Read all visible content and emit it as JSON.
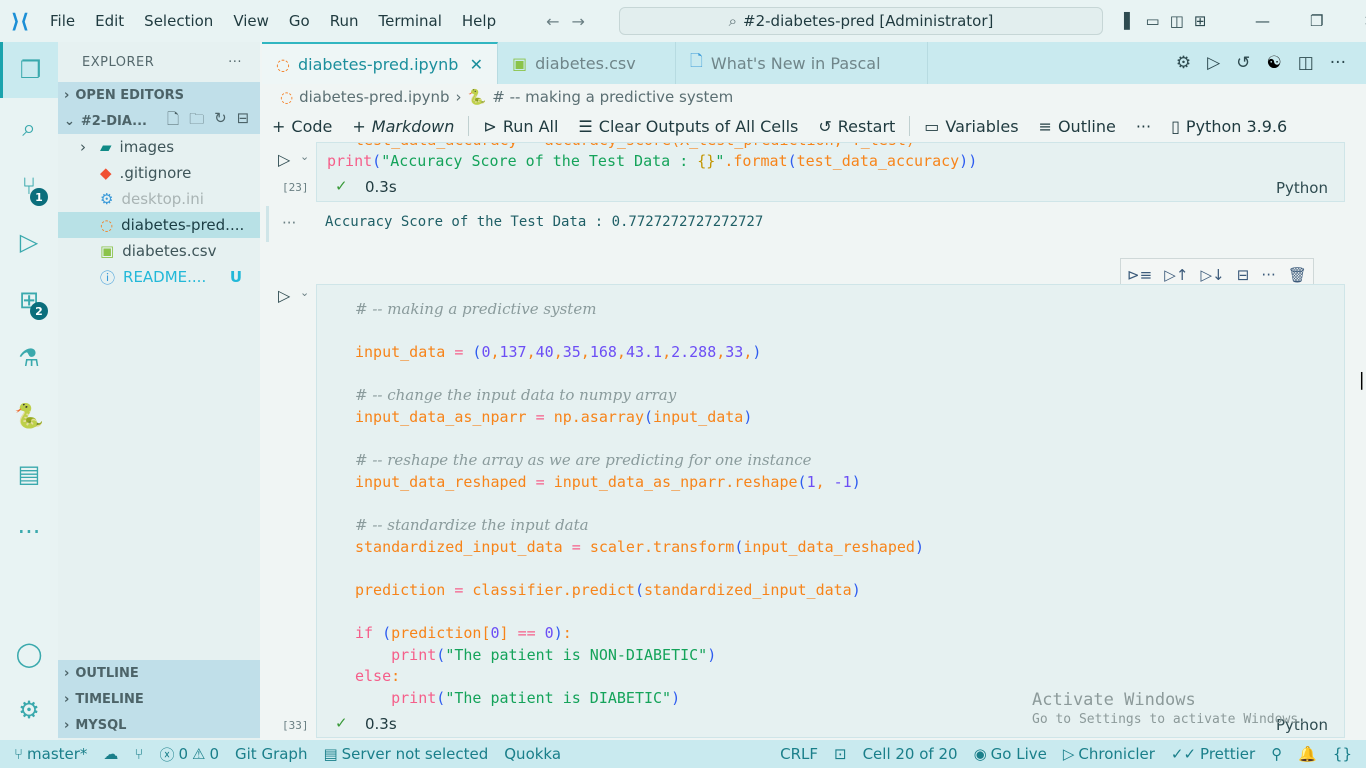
{
  "titlebar": {
    "menus": [
      "File",
      "Edit",
      "Selection",
      "View",
      "Go",
      "Run",
      "Terminal",
      "Help"
    ],
    "command_center": "#2-diabetes-pred [Administrator]"
  },
  "activity": {
    "scm_badge": "1",
    "extensions_badge": "2"
  },
  "sidebar": {
    "title": "EXPLORER",
    "more": "···",
    "open_editors": "OPEN EDITORS",
    "folder": "#2-DIA...",
    "files": [
      {
        "name": "images",
        "icon": "folder-icon",
        "color": "#3e5559"
      },
      {
        "name": ".gitignore",
        "icon": "git-icon",
        "color": "#3e5559"
      },
      {
        "name": "desktop.ini",
        "icon": "gear-icon",
        "color": "#a9b4b4"
      },
      {
        "name": "diabetes-pred....",
        "icon": "jupyter-icon",
        "color": "#1b3d44"
      },
      {
        "name": "diabetes.csv",
        "icon": "csv-icon",
        "color": "#3e5559"
      },
      {
        "name": "README....",
        "icon": "info-icon",
        "color": "#22b8d8",
        "badge": "U"
      }
    ],
    "outline": "OUTLINE",
    "timeline": "TIMELINE",
    "mysql": "MYSQL"
  },
  "tabs": [
    {
      "label": "diabetes-pred.ipynb",
      "active": true
    },
    {
      "label": "diabetes.csv"
    },
    {
      "label": "What's New in Pascal"
    }
  ],
  "breadcrumb": {
    "file": "diabetes-pred.ipynb",
    "symbol": "# -- making a predictive system"
  },
  "toolbar": {
    "code": "Code",
    "markdown": "Markdown",
    "run_all": "Run All",
    "clear": "Clear Outputs of All Cells",
    "restart": "Restart",
    "variables": "Variables",
    "outline": "Outline",
    "more": "···",
    "kernel": "Python 3.9.6"
  },
  "cell1": {
    "partial_line": "test_data_accuracy = accuracy_score(X_test_prediction, Y_test)",
    "exec": "[23]",
    "time": "0.3s",
    "lang": "Python",
    "output": "Accuracy Score of the Test Data : 0.7727272727272727",
    "print_line": [
      [
        "fn",
        "print"
      ],
      [
        "par",
        "("
      ],
      [
        "str",
        "\"Accuracy Score of the Test Data : "
      ],
      [
        "brk",
        "{}"
      ],
      [
        "str",
        "\""
      ],
      [
        "var",
        ".format"
      ],
      [
        "par",
        "("
      ],
      [
        "var",
        "test_data_accuracy"
      ],
      [
        "par",
        "))"
      ]
    ]
  },
  "cell2": {
    "exec": "[33]",
    "time": "0.3s",
    "lang": "Python",
    "lines": [
      [
        [
          "com",
          "# -- making a predictive system"
        ]
      ],
      [],
      [
        [
          "var",
          "input_data "
        ],
        [
          "op",
          "= "
        ],
        [
          "par",
          "("
        ],
        [
          "num",
          "0"
        ],
        [
          "var",
          ","
        ],
        [
          "num",
          "137"
        ],
        [
          "var",
          ","
        ],
        [
          "num",
          "40"
        ],
        [
          "var",
          ","
        ],
        [
          "num",
          "35"
        ],
        [
          "var",
          ","
        ],
        [
          "num",
          "168"
        ],
        [
          "var",
          ","
        ],
        [
          "num",
          "43.1"
        ],
        [
          "var",
          ","
        ],
        [
          "num",
          "2.288"
        ],
        [
          "var",
          ","
        ],
        [
          "num",
          "33"
        ],
        [
          "var",
          ","
        ],
        [
          "par",
          ")"
        ]
      ],
      [],
      [
        [
          "com",
          "# -- change the input data to numpy array"
        ]
      ],
      [
        [
          "var",
          "input_data_as_nparr "
        ],
        [
          "op",
          "= "
        ],
        [
          "var",
          "np.asarray"
        ],
        [
          "par",
          "("
        ],
        [
          "var",
          "input_data"
        ],
        [
          "par",
          ")"
        ]
      ],
      [],
      [
        [
          "com",
          "# -- reshape the array as we are predicting for one instance"
        ]
      ],
      [
        [
          "var",
          "input_data_reshaped "
        ],
        [
          "op",
          "= "
        ],
        [
          "var",
          "input_data_as_nparr.reshape"
        ],
        [
          "par",
          "("
        ],
        [
          "num",
          "1"
        ],
        [
          "var",
          ", "
        ],
        [
          "num",
          "-1"
        ],
        [
          "par",
          ")"
        ]
      ],
      [],
      [
        [
          "com",
          "# -- standardize the input data"
        ]
      ],
      [
        [
          "var",
          "standardized_input_data "
        ],
        [
          "op",
          "= "
        ],
        [
          "var",
          "scaler.transform"
        ],
        [
          "par",
          "("
        ],
        [
          "var",
          "input_data_reshaped"
        ],
        [
          "par",
          ")"
        ]
      ],
      [],
      [
        [
          "var",
          "prediction "
        ],
        [
          "op",
          "= "
        ],
        [
          "var",
          "classifier.predict"
        ],
        [
          "par",
          "("
        ],
        [
          "var",
          "standardized_input_data"
        ],
        [
          "par",
          ")"
        ]
      ],
      [],
      [
        [
          "kw",
          "if "
        ],
        [
          "par",
          "("
        ],
        [
          "var",
          "prediction"
        ],
        [
          "var",
          "["
        ],
        [
          "num",
          "0"
        ],
        [
          "var",
          "] "
        ],
        [
          "op",
          "== "
        ],
        [
          "num",
          "0"
        ],
        [
          "par",
          ")"
        ],
        [
          "var",
          ":"
        ]
      ],
      [
        [
          "pl",
          "    "
        ],
        [
          "fn",
          "print"
        ],
        [
          "par",
          "("
        ],
        [
          "str",
          "\"The patient is NON-DIABETIC\""
        ],
        [
          "par",
          ")"
        ]
      ],
      [
        [
          "kw",
          "else"
        ],
        [
          "var",
          ":"
        ]
      ],
      [
        [
          "pl",
          "    "
        ],
        [
          "fn",
          "print"
        ],
        [
          "par",
          "("
        ],
        [
          "str",
          "\"The patient is DIABETIC\""
        ],
        [
          "par",
          ")"
        ]
      ]
    ]
  },
  "statusbar": {
    "branch": "master*",
    "errors": "0",
    "warnings": "0",
    "git_graph": "Git Graph",
    "server": "Server not selected",
    "quokka": "Quokka",
    "eol": "CRLF",
    "cell": "Cell 20 of 20",
    "go_live": "Go Live",
    "chronicler": "Chronicler",
    "prettier": "Prettier"
  },
  "watermark": {
    "title": "Activate Windows",
    "subtitle": "Go to Settings to activate Windows."
  }
}
